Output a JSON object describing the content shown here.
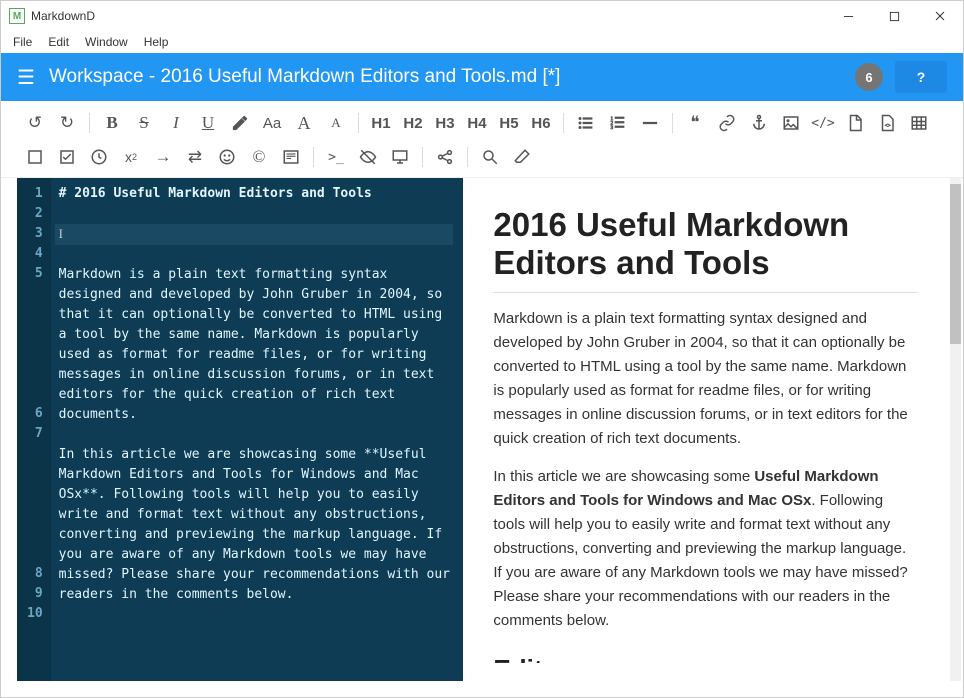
{
  "colors": {
    "accent": "#2196f3",
    "editor_bg": "#0d3c54"
  },
  "titlebar": {
    "app_name": "MarkdownD"
  },
  "menubar": {
    "file": "File",
    "edit": "Edit",
    "window": "Window",
    "help": "Help"
  },
  "header": {
    "doc_title": "Workspace - 2016 Useful Markdown Editors and Tools.md [*]",
    "badge": "6",
    "help": "?"
  },
  "toolbar": {
    "undo": "↺",
    "redo": "↻",
    "bold": "B",
    "strike": "S",
    "italic": "I",
    "underline": "U",
    "h1": "H1",
    "h2": "H2",
    "h3": "H3",
    "h4": "H4",
    "h5": "H5",
    "h6": "H6",
    "aa": "Aa",
    "acap": "A",
    "asmall": "A",
    "quote": "❝"
  },
  "editor": {
    "lines": [
      {
        "n": "1",
        "text": "# 2016 Useful Markdown Editors and Tools",
        "cls": "bold-md"
      },
      {
        "n": "2",
        "text": ""
      },
      {
        "n": "3",
        "text": "",
        "active": true,
        "caret": true
      },
      {
        "n": "4",
        "text": ""
      },
      {
        "n": "5",
        "text": "Markdown is a plain text formatting syntax designed and developed by John Gruber in 2004, so that it can optionally be converted to HTML using a tool by the same name. Markdown is popularly used as format for readme files, or for writing messages in online discussion forums, or in text editors for the quick creation of rich text documents."
      },
      {
        "n": "6",
        "text": ""
      },
      {
        "n": "7",
        "text": "In this article we are showcasing some **Useful Markdown Editors and Tools for Windows and Mac OSx**. Following tools will help you to easily write and format text without any obstructions, converting and previewing the markup language. If you are aware of any Markdown tools we may have missed? Please share your recommendations with our readers in the comments below."
      },
      {
        "n": "8",
        "text": ""
      },
      {
        "n": "9",
        "text": ""
      },
      {
        "n": "10",
        "text": ""
      }
    ]
  },
  "preview": {
    "h1": "2016 Useful Markdown Editors and Tools",
    "p1": "Markdown is a plain text formatting syntax designed and developed by John Gruber in 2004, so that it can optionally be converted to HTML using a tool by the same name. Markdown is popularly used as format for readme files, or for writing messages in online discussion forums, or in text editors for the quick creation of rich text documents.",
    "p2_pre": "In this article we are showcasing some ",
    "p2_bold": "Useful Markdown Editors and Tools for Windows and Mac OSx",
    "p2_post": ". Following tools will help you to easily write and format text without any obstructions, converting and previewing the markup language. If you are aware of any Markdown tools we may have missed? Please share your recommendations with our readers in the comments below.",
    "h2_cut": "Editors"
  }
}
